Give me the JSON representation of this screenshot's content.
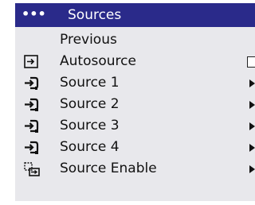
{
  "menu": {
    "title_dots": "•••",
    "title": "Sources",
    "items": [
      {
        "label": "Previous",
        "icon": "none",
        "control": "none"
      },
      {
        "label": "Autosource",
        "icon": "autosource-icon",
        "control": "checkbox"
      },
      {
        "label": "Source 1",
        "icon": "source-input-icon",
        "control": "submenu-arrow"
      },
      {
        "label": "Source 2",
        "icon": "source-input-icon",
        "control": "submenu-arrow"
      },
      {
        "label": "Source 3",
        "icon": "source-input-icon",
        "control": "submenu-arrow"
      },
      {
        "label": "Source 4",
        "icon": "source-input-icon",
        "control": "submenu-arrow"
      },
      {
        "label": "Source Enable",
        "icon": "source-enable-icon",
        "control": "submenu-arrow"
      }
    ]
  },
  "colors": {
    "title_bar": "#2a2a8a",
    "menu_background": "#e8e8ec",
    "text": "#111111"
  }
}
